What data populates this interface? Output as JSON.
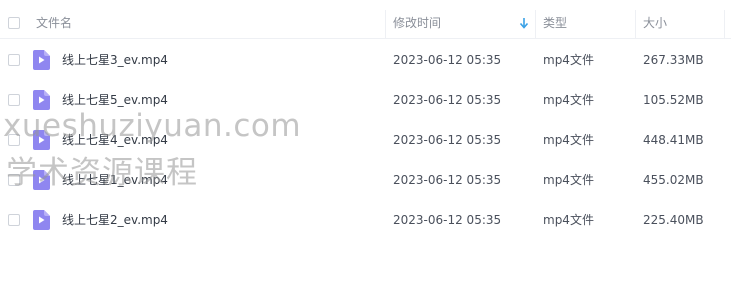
{
  "table": {
    "columns": {
      "name": "文件名",
      "modified": "修改时间",
      "type": "类型",
      "size": "大小"
    },
    "sort": {
      "column": "modified",
      "direction": "descending"
    },
    "rows": [
      {
        "name": "线上七星3_ev.mp4",
        "modified": "2023-06-12 05:35",
        "type": "mp4文件",
        "size": "267.33MB",
        "icon": "video-file-icon"
      },
      {
        "name": "线上七星5_ev.mp4",
        "modified": "2023-06-12 05:35",
        "type": "mp4文件",
        "size": "105.52MB",
        "icon": "video-file-icon"
      },
      {
        "name": "线上七星4_ev.mp4",
        "modified": "2023-06-12 05:35",
        "type": "mp4文件",
        "size": "448.41MB",
        "icon": "video-file-icon"
      },
      {
        "name": "线上七星1_ev.mp4",
        "modified": "2023-06-12 05:35",
        "type": "mp4文件",
        "size": "455.02MB",
        "icon": "video-file-icon"
      },
      {
        "name": "线上七星2_ev.mp4",
        "modified": "2023-06-12 05:35",
        "type": "mp4文件",
        "size": "225.40MB",
        "icon": "video-file-icon"
      }
    ]
  },
  "watermark": {
    "line1": "xueshuziyuan.com",
    "line2": "学术资源课程"
  },
  "colors": {
    "file_icon": "#8f86f0",
    "sort_arrow": "#3aa1e6",
    "border": "#eef0f4"
  }
}
